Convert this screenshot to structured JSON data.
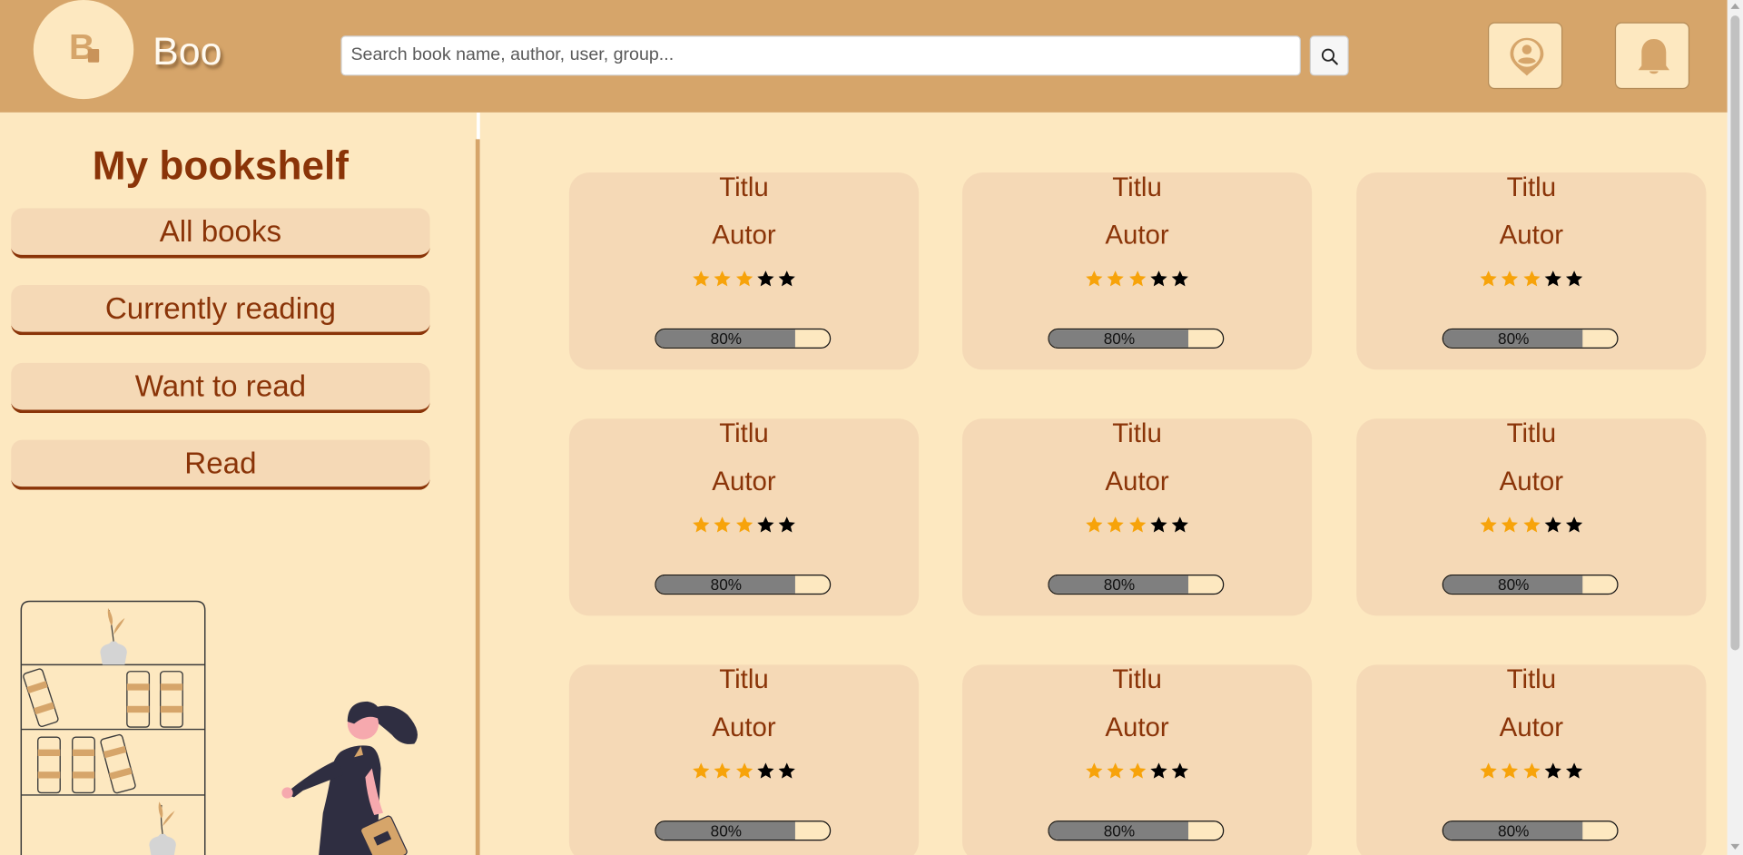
{
  "header": {
    "logo_letter": "B",
    "brand": "Boo",
    "search_placeholder": "Search book name, author, user, group...",
    "search_button_icon": "search-icon",
    "profile_button_icon": "user-pin-icon",
    "notifications_button_icon": "bell-icon"
  },
  "sidebar": {
    "title": "My bookshelf",
    "buttons": [
      {
        "label": "All books"
      },
      {
        "label": "Currently reading"
      },
      {
        "label": "Want to read"
      },
      {
        "label": "Read"
      }
    ]
  },
  "books": [
    {
      "title": "Titlu",
      "author": "Autor",
      "rating": 3,
      "max_rating": 5,
      "progress": 80,
      "progress_label": "80%"
    },
    {
      "title": "Titlu",
      "author": "Autor",
      "rating": 3,
      "max_rating": 5,
      "progress": 80,
      "progress_label": "80%"
    },
    {
      "title": "Titlu",
      "author": "Autor",
      "rating": 3,
      "max_rating": 5,
      "progress": 80,
      "progress_label": "80%"
    },
    {
      "title": "Titlu",
      "author": "Autor",
      "rating": 3,
      "max_rating": 5,
      "progress": 80,
      "progress_label": "80%"
    },
    {
      "title": "Titlu",
      "author": "Autor",
      "rating": 3,
      "max_rating": 5,
      "progress": 80,
      "progress_label": "80%"
    },
    {
      "title": "Titlu",
      "author": "Autor",
      "rating": 3,
      "max_rating": 5,
      "progress": 80,
      "progress_label": "80%"
    },
    {
      "title": "Titlu",
      "author": "Autor",
      "rating": 3,
      "max_rating": 5,
      "progress": 80,
      "progress_label": "80%"
    },
    {
      "title": "Titlu",
      "author": "Autor",
      "rating": 3,
      "max_rating": 5,
      "progress": 80,
      "progress_label": "80%"
    },
    {
      "title": "Titlu",
      "author": "Autor",
      "rating": 3,
      "max_rating": 5,
      "progress": 80,
      "progress_label": "80%"
    }
  ],
  "colors": {
    "header_bg": "#d6a56a",
    "page_bg": "#fde8c0",
    "card_bg": "#f5d9b6",
    "text_brown": "#8a3408",
    "star_filled": "#f7a30a",
    "star_empty": "#000000",
    "progress_fill": "#7f7f7f"
  }
}
